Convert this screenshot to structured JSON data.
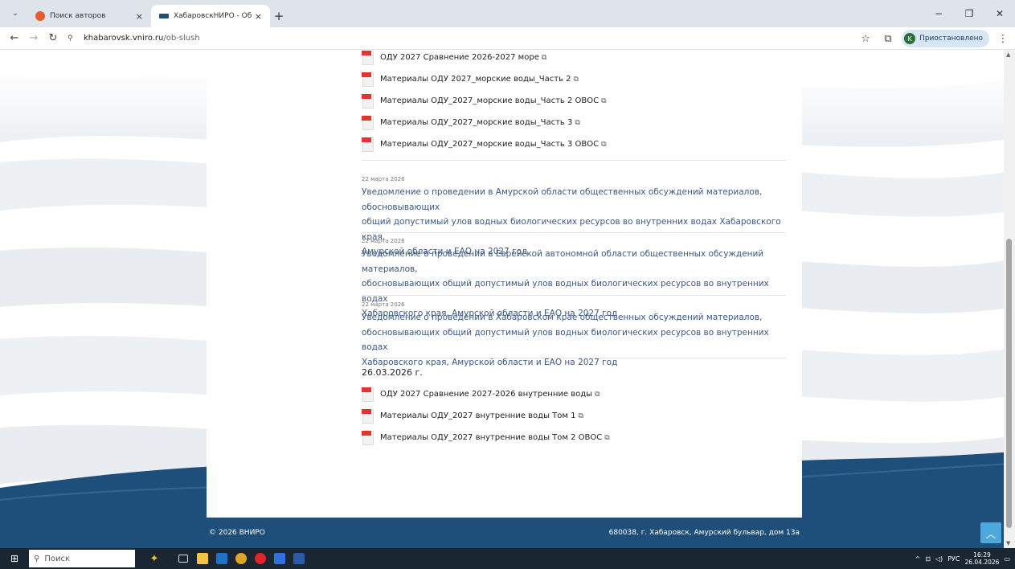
{
  "browser": {
    "tabs": [
      {
        "title": "Поиск авторов",
        "active": false
      },
      {
        "title": "ХабаровскНИРО - Обществен",
        "active": true
      }
    ],
    "url_host": "khabarovsk.vniro.ru",
    "url_path": "/ob-slush",
    "profile_label": "Приостановлено",
    "profile_initial": "K"
  },
  "page": {
    "docs_top": [
      {
        "label": "ОДУ 2027 Сравнение 2026-2027 море"
      },
      {
        "label": "Материалы ОДУ 2027_морские воды_Часть 2"
      },
      {
        "label": "Материалы ОДУ_2027_морские воды_Часть 2 ОВОС"
      },
      {
        "label": "Материалы ОДУ_2027_морские воды_Часть 3"
      },
      {
        "label": "Материалы ОДУ_2027_морские воды_Часть 3 ОВОС"
      }
    ],
    "news": [
      {
        "date": "22 марта 2026",
        "lines": [
          "Уведомление о проведении в Амурской области общественных обсуждений материалов, обосновывающих",
          "общий допустимый улов водных биологических ресурсов во внутренних водах Хабаровского края,",
          "Амурской области и ЕАО на 2027 год"
        ]
      },
      {
        "date": "22 марта 2026",
        "lines": [
          "Уведомление о проведении в Еврейской автономной области общественных обсуждений материалов,",
          "обосновывающих общий допустимый улов водных биологических ресурсов во внутренних водах",
          "Хабаровского края, Амурской области и ЕАО на 2027 год"
        ]
      },
      {
        "date": "22 марта 2026",
        "lines": [
          "Уведомление о проведении в Хабаровском крае общественных обсуждений материалов,",
          "обосновывающих общий допустимый улов водных биологических ресурсов во внутренних водах",
          "Хабаровского края, Амурской области и ЕАО на 2027 год"
        ]
      }
    ],
    "section_date": "26.03.2026 г.",
    "docs_bottom": [
      {
        "label": "ОДУ 2027 Сравнение 2027-2026 внутренние воды"
      },
      {
        "label": "Материалы ОДУ_2027 внутренние воды Том 1"
      },
      {
        "label": "Материалы ОДУ_2027 внутренние воды Том 2 ОВОС"
      }
    ],
    "footer_left": "© 2026 ВНИРО",
    "footer_right": "680038, г. Хабаровск, Амурский бульвар, дом 13а"
  },
  "taskbar": {
    "search_label": "Поиск",
    "lang": "РУС",
    "time": "16:29",
    "date": "26.04.2026"
  },
  "colors": {
    "link": "#3a5a82",
    "footer": "#1e4e7a",
    "pdf_badge": "#e3342f",
    "scroll_top_button": "#4fa8dc"
  },
  "icons": {
    "doc": "pdf-file-icon",
    "external": "external-link-icon"
  }
}
